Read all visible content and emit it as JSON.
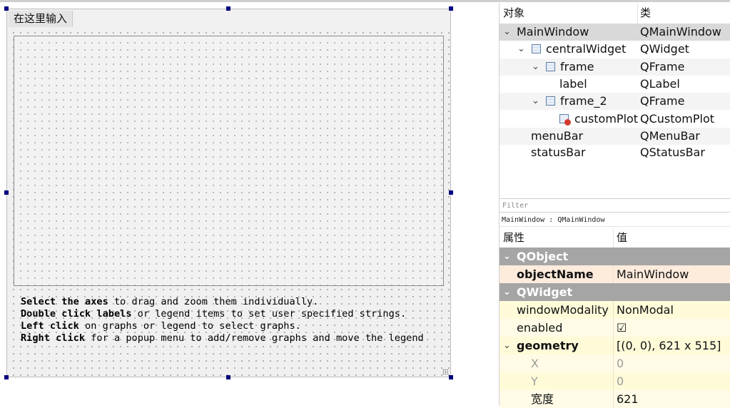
{
  "form": {
    "menu_entry": "在这里输入",
    "help_lines": [
      {
        "bold": "Select the axes",
        "rest": " to drag and zoom them individually."
      },
      {
        "bold": "Double click labels",
        "rest": " or legend items to set user specified strings."
      },
      {
        "bold": "Left click",
        "rest": " on graphs or legend to select graphs."
      },
      {
        "bold": "Right click",
        "rest": " for a popup menu to add/remove graphs and move the legend"
      }
    ]
  },
  "object_inspector": {
    "col_object": "对象",
    "col_class": "类",
    "rows": [
      {
        "name": "MainWindow",
        "cls": "QMainWindow"
      },
      {
        "name": "centralWidget",
        "cls": "QWidget"
      },
      {
        "name": "frame",
        "cls": "QFrame"
      },
      {
        "name": "label",
        "cls": "QLabel"
      },
      {
        "name": "frame_2",
        "cls": "QFrame"
      },
      {
        "name": "customPlot",
        "cls": "QCustomPlot"
      },
      {
        "name": "menuBar",
        "cls": "QMenuBar"
      },
      {
        "name": "statusBar",
        "cls": "QStatusBar"
      }
    ]
  },
  "property_editor": {
    "filter_placeholder": "Filter",
    "context": "MainWindow : QMainWindow",
    "col_property": "属性",
    "col_value": "值",
    "group_qobject": "QObject",
    "objectName_label": "objectName",
    "objectName_value": "MainWindow",
    "group_qwidget": "QWidget",
    "windowModality_label": "windowModality",
    "windowModality_value": "NonModal",
    "enabled_label": "enabled",
    "enabled_value": "☑",
    "geometry_label": "geometry",
    "geometry_value": "[(0, 0), 621 x 515]",
    "x_label": "X",
    "x_value": "0",
    "y_label": "Y",
    "y_value": "0",
    "width_label": "宽度",
    "width_value": "621"
  },
  "colors": {
    "selection_handle": "#000080",
    "group_header": "#a5a5a5",
    "qobject_row": "#fdebdc",
    "qwidget_row": "#fffbd9"
  }
}
